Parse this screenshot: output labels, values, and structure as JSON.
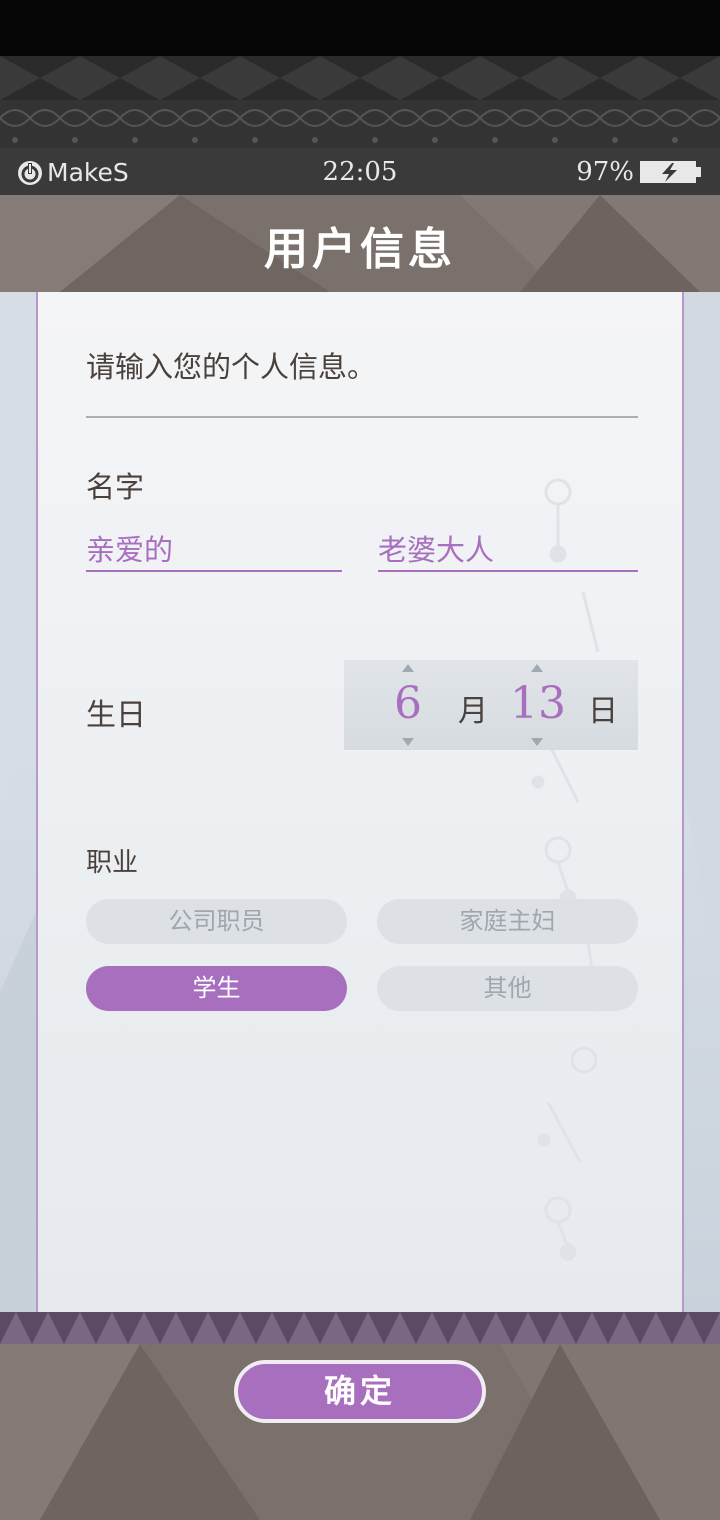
{
  "status_bar": {
    "brand": "MakeS",
    "time": "22:05",
    "battery": "97%"
  },
  "header": {
    "title": "用户信息"
  },
  "form": {
    "intro": "请输入您的个人信息。",
    "name_label": "名字",
    "first_name": "亲爱的",
    "last_name": "老婆大人",
    "birthday_label": "生日",
    "birthday_month": "6",
    "month_unit": "月",
    "birthday_day": "13",
    "day_unit": "日",
    "occupation_label": "职业",
    "occupations": [
      {
        "label": "公司职员",
        "selected": false
      },
      {
        "label": "家庭主妇",
        "selected": false
      },
      {
        "label": "学生",
        "selected": true
      },
      {
        "label": "其他",
        "selected": false
      }
    ]
  },
  "footer": {
    "confirm_label": "确定"
  },
  "colors": {
    "accent": "#a86fbf",
    "header_bg": "#7a706c",
    "text": "#4a403c"
  }
}
